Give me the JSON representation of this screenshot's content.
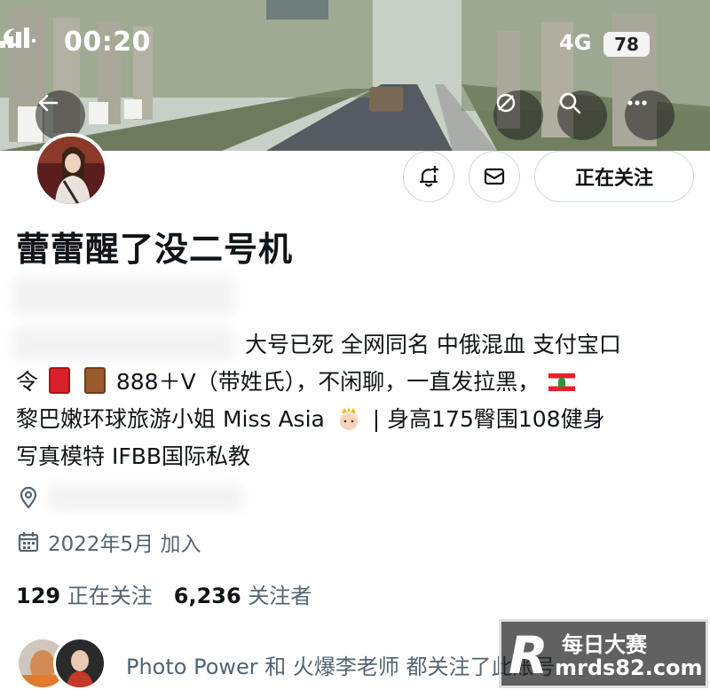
{
  "status_bar": {
    "time": "00:20",
    "network": "4G",
    "battery": "78"
  },
  "profile": {
    "display_name": "蕾蕾醒了没二号机",
    "follow_button_label": "正在关注",
    "bio": {
      "line1": "大号已死 全网同名 中俄混血 支付宝口",
      "line2_a": "令",
      "line2_b": "888＋V（带姓氏），不闲聊，一直发拉黑，",
      "line3_a": "黎巴嫩环球旅游小姐 Miss Asia",
      "line3_b": "| 身高175臀围108健身",
      "line4": "写真模特 IFBB国际私教"
    },
    "joined": "2022年5月 加入",
    "following_count": "129",
    "following_label": "正在关注",
    "followers_count": "6,236",
    "followers_label": "关注者",
    "mutuals_text": "Photo Power 和 火爆李老师 都关注了此账号"
  },
  "icons": {
    "back": "back-arrow-icon",
    "mute": "mute-icon",
    "search": "search-icon",
    "more": "more-icon",
    "notify": "bell-plus-icon",
    "message": "envelope-icon",
    "location": "location-pin-icon",
    "calendar": "calendar-icon"
  },
  "watermark": {
    "logo": "R",
    "title": "每日大赛",
    "url": "mrds82.com"
  },
  "colors": {
    "secondary_text": "#536471",
    "primary_text": "#0f1419",
    "border": "#cfd9de"
  }
}
